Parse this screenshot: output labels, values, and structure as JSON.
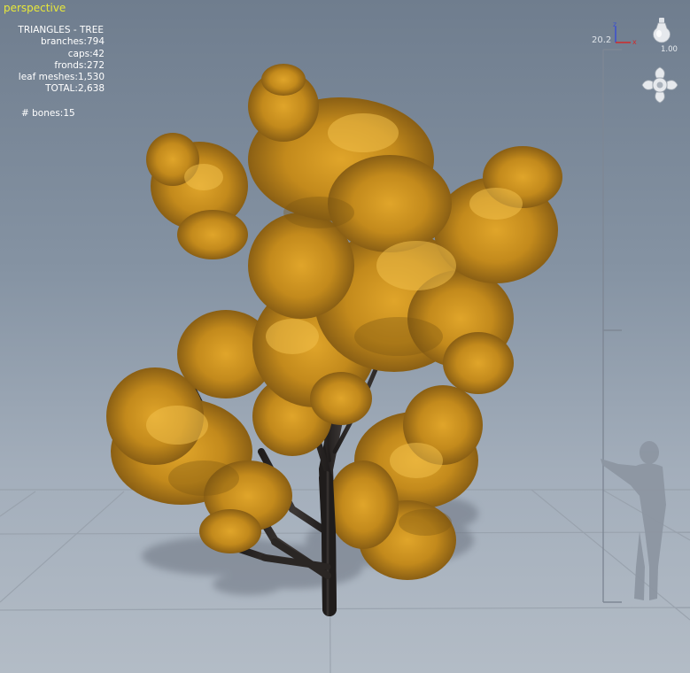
{
  "viewport": {
    "label": "perspective",
    "stats": {
      "title": "TRIANGLES - TREE",
      "rows": [
        {
          "label": "branches",
          "value": "794"
        },
        {
          "label": "caps",
          "value": "42"
        },
        {
          "label": "fronds",
          "value": "272"
        },
        {
          "label": "leaf meshes",
          "value": "1,530"
        },
        {
          "label": "TOTAL",
          "value": "2,638"
        }
      ],
      "bones": "# bones:15"
    },
    "scale_value": "20.2",
    "zoom_value": "1.00",
    "axis_labels": {
      "z": "z",
      "x": "x"
    }
  },
  "colors": {
    "label_yellow": "#e8e83a",
    "foliage": "#c9901c",
    "trunk": "#2e2a28",
    "ground_grid": "#8f98a3"
  },
  "icons": [
    "axis-gizmo-icon",
    "light-bulb-icon",
    "camera-orbit-icon",
    "human-scale-figure-icon"
  ]
}
